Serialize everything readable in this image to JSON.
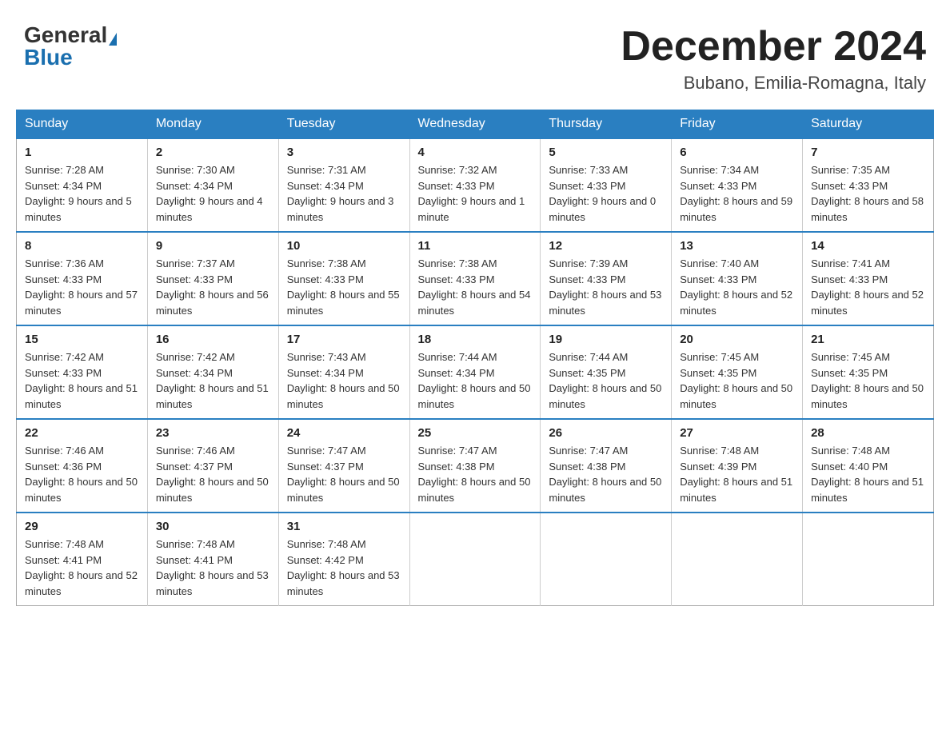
{
  "header": {
    "logo_general": "General",
    "logo_blue": "Blue",
    "title": "December 2024",
    "subtitle": "Bubano, Emilia-Romagna, Italy"
  },
  "calendar": {
    "days_of_week": [
      "Sunday",
      "Monday",
      "Tuesday",
      "Wednesday",
      "Thursday",
      "Friday",
      "Saturday"
    ],
    "weeks": [
      [
        {
          "day": "1",
          "sunrise": "7:28 AM",
          "sunset": "4:34 PM",
          "daylight": "9 hours and 5 minutes."
        },
        {
          "day": "2",
          "sunrise": "7:30 AM",
          "sunset": "4:34 PM",
          "daylight": "9 hours and 4 minutes."
        },
        {
          "day": "3",
          "sunrise": "7:31 AM",
          "sunset": "4:34 PM",
          "daylight": "9 hours and 3 minutes."
        },
        {
          "day": "4",
          "sunrise": "7:32 AM",
          "sunset": "4:33 PM",
          "daylight": "9 hours and 1 minute."
        },
        {
          "day": "5",
          "sunrise": "7:33 AM",
          "sunset": "4:33 PM",
          "daylight": "9 hours and 0 minutes."
        },
        {
          "day": "6",
          "sunrise": "7:34 AM",
          "sunset": "4:33 PM",
          "daylight": "8 hours and 59 minutes."
        },
        {
          "day": "7",
          "sunrise": "7:35 AM",
          "sunset": "4:33 PM",
          "daylight": "8 hours and 58 minutes."
        }
      ],
      [
        {
          "day": "8",
          "sunrise": "7:36 AM",
          "sunset": "4:33 PM",
          "daylight": "8 hours and 57 minutes."
        },
        {
          "day": "9",
          "sunrise": "7:37 AM",
          "sunset": "4:33 PM",
          "daylight": "8 hours and 56 minutes."
        },
        {
          "day": "10",
          "sunrise": "7:38 AM",
          "sunset": "4:33 PM",
          "daylight": "8 hours and 55 minutes."
        },
        {
          "day": "11",
          "sunrise": "7:38 AM",
          "sunset": "4:33 PM",
          "daylight": "8 hours and 54 minutes."
        },
        {
          "day": "12",
          "sunrise": "7:39 AM",
          "sunset": "4:33 PM",
          "daylight": "8 hours and 53 minutes."
        },
        {
          "day": "13",
          "sunrise": "7:40 AM",
          "sunset": "4:33 PM",
          "daylight": "8 hours and 52 minutes."
        },
        {
          "day": "14",
          "sunrise": "7:41 AM",
          "sunset": "4:33 PM",
          "daylight": "8 hours and 52 minutes."
        }
      ],
      [
        {
          "day": "15",
          "sunrise": "7:42 AM",
          "sunset": "4:33 PM",
          "daylight": "8 hours and 51 minutes."
        },
        {
          "day": "16",
          "sunrise": "7:42 AM",
          "sunset": "4:34 PM",
          "daylight": "8 hours and 51 minutes."
        },
        {
          "day": "17",
          "sunrise": "7:43 AM",
          "sunset": "4:34 PM",
          "daylight": "8 hours and 50 minutes."
        },
        {
          "day": "18",
          "sunrise": "7:44 AM",
          "sunset": "4:34 PM",
          "daylight": "8 hours and 50 minutes."
        },
        {
          "day": "19",
          "sunrise": "7:44 AM",
          "sunset": "4:35 PM",
          "daylight": "8 hours and 50 minutes."
        },
        {
          "day": "20",
          "sunrise": "7:45 AM",
          "sunset": "4:35 PM",
          "daylight": "8 hours and 50 minutes."
        },
        {
          "day": "21",
          "sunrise": "7:45 AM",
          "sunset": "4:35 PM",
          "daylight": "8 hours and 50 minutes."
        }
      ],
      [
        {
          "day": "22",
          "sunrise": "7:46 AM",
          "sunset": "4:36 PM",
          "daylight": "8 hours and 50 minutes."
        },
        {
          "day": "23",
          "sunrise": "7:46 AM",
          "sunset": "4:37 PM",
          "daylight": "8 hours and 50 minutes."
        },
        {
          "day": "24",
          "sunrise": "7:47 AM",
          "sunset": "4:37 PM",
          "daylight": "8 hours and 50 minutes."
        },
        {
          "day": "25",
          "sunrise": "7:47 AM",
          "sunset": "4:38 PM",
          "daylight": "8 hours and 50 minutes."
        },
        {
          "day": "26",
          "sunrise": "7:47 AM",
          "sunset": "4:38 PM",
          "daylight": "8 hours and 50 minutes."
        },
        {
          "day": "27",
          "sunrise": "7:48 AM",
          "sunset": "4:39 PM",
          "daylight": "8 hours and 51 minutes."
        },
        {
          "day": "28",
          "sunrise": "7:48 AM",
          "sunset": "4:40 PM",
          "daylight": "8 hours and 51 minutes."
        }
      ],
      [
        {
          "day": "29",
          "sunrise": "7:48 AM",
          "sunset": "4:41 PM",
          "daylight": "8 hours and 52 minutes."
        },
        {
          "day": "30",
          "sunrise": "7:48 AM",
          "sunset": "4:41 PM",
          "daylight": "8 hours and 53 minutes."
        },
        {
          "day": "31",
          "sunrise": "7:48 AM",
          "sunset": "4:42 PM",
          "daylight": "8 hours and 53 minutes."
        },
        null,
        null,
        null,
        null
      ]
    ]
  }
}
